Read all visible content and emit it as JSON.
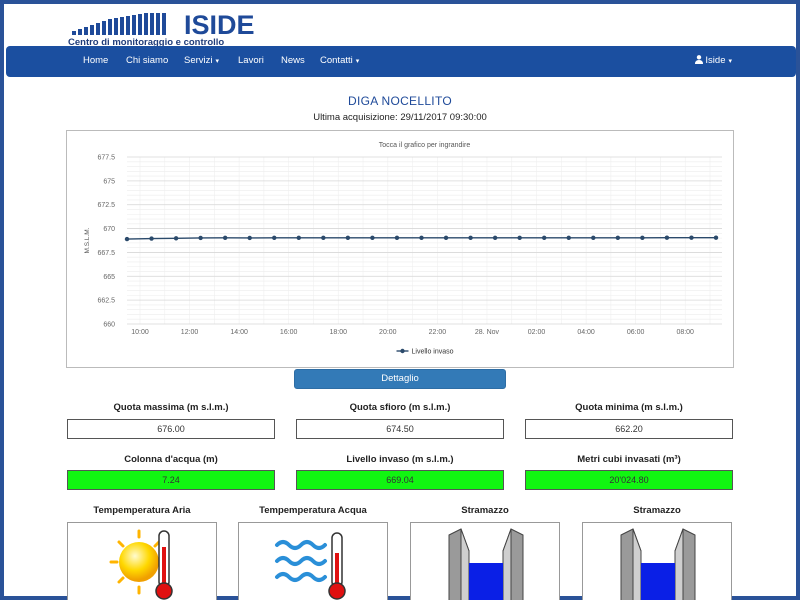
{
  "brand": {
    "name": "ISIDE",
    "subtitle": "Centro di monitoraggio e controllo",
    "color": "#1f4a99"
  },
  "nav": {
    "items": [
      {
        "label": "Home"
      },
      {
        "label": "Chi siamo"
      },
      {
        "label": "Servizi",
        "caret": "▾"
      },
      {
        "label": "Lavori"
      },
      {
        "label": "News"
      },
      {
        "label": "Contatti",
        "caret": "▾"
      }
    ],
    "user": {
      "label": "Iside",
      "icon": "user-icon",
      "caret": "▾"
    },
    "background": "#1b4fa0"
  },
  "page": {
    "title": "DIGA NOCELLITO",
    "acquisition": "Ultima acquisizione: 29/11/2017 09:30:00"
  },
  "chart_data": {
    "type": "line",
    "title": "Tocca il grafico per ingrandire",
    "ylabel": "M.S.L.M.",
    "yticks": [
      "677.5",
      "675",
      "672.5",
      "670",
      "667.5",
      "665",
      "662.5",
      "660"
    ],
    "ylim": [
      660,
      677.5
    ],
    "xticks": [
      "10:00",
      "12:00",
      "14:00",
      "16:00",
      "18:00",
      "20:00",
      "22:00",
      "28. Nov",
      "02:00",
      "04:00",
      "06:00",
      "08:00"
    ],
    "grid": true,
    "legend_position": "bottom",
    "series": [
      {
        "name": "Livello invaso",
        "color": "#2b4a6b",
        "values": [
          668.9,
          668.95,
          668.98,
          669.02,
          669.03,
          669.02,
          669.03,
          669.03,
          669.03,
          669.03,
          669.03,
          669.03,
          669.03,
          669.03,
          669.03,
          669.03,
          669.03,
          669.03,
          669.03,
          669.03,
          669.03,
          669.03,
          669.04,
          669.04,
          669.04
        ]
      }
    ]
  },
  "detail_button": {
    "label": "Dettaglio"
  },
  "stats_row1": [
    {
      "label": "Quota massima (m s.l.m.)",
      "value": "676.00"
    },
    {
      "label": "Quota sfioro (m s.l.m.)",
      "value": "674.50"
    },
    {
      "label": "Quota minima (m s.l.m.)",
      "value": "662.20"
    }
  ],
  "stats_row2": [
    {
      "label": "Colonna d'acqua (m)",
      "value": "7.24"
    },
    {
      "label": "Livello invaso (m s.l.m.)",
      "value": "669.04"
    },
    {
      "label": "Metri cubi invasati (m³)",
      "value": "20'024.80"
    }
  ],
  "highlight_color": "#11f511",
  "cards": [
    {
      "label": "Tempemperatura Aria",
      "icon": "sun-thermometer-icon"
    },
    {
      "label": "Tempemperatura Acqua",
      "icon": "water-thermometer-icon"
    },
    {
      "label": "Stramazzo",
      "icon": "weir-icon"
    },
    {
      "label": "Stramazzo",
      "icon": "weir-icon"
    }
  ]
}
